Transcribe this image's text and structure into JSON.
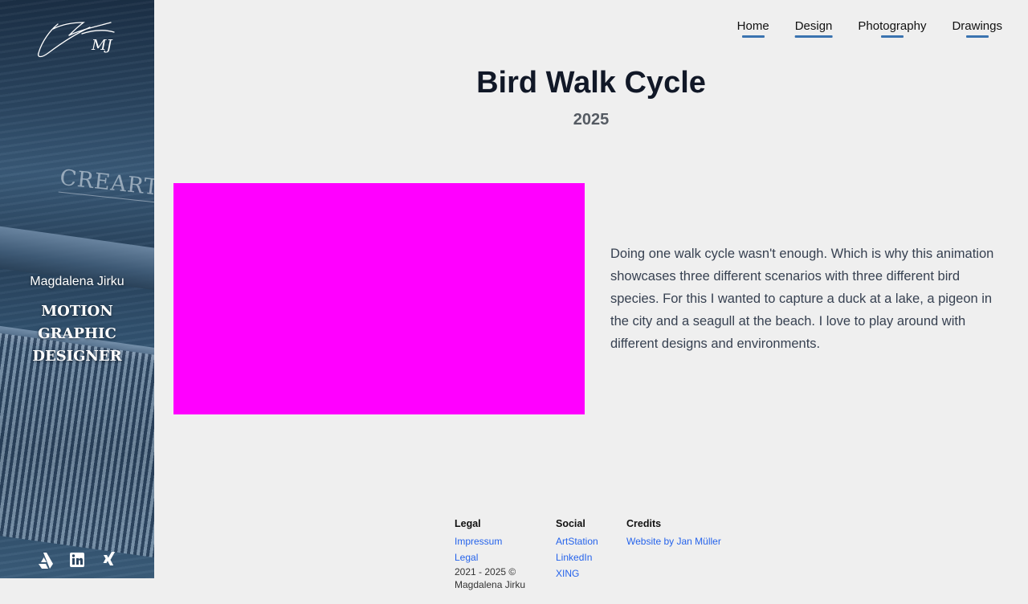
{
  "sidebar": {
    "logo_initials": "MJ",
    "engraving_text": "CREARTI",
    "name": "Magdalena Jirku",
    "role": "MOTION GRAPHIC DESIGNER",
    "social_icons": [
      "artstation-icon",
      "linkedin-icon",
      "xing-icon"
    ]
  },
  "nav": {
    "items": [
      {
        "label": "Home"
      },
      {
        "label": "Design",
        "active": true
      },
      {
        "label": "Photography"
      },
      {
        "label": "Drawings"
      }
    ],
    "underline_color": "#3a73b0"
  },
  "project": {
    "title": "Bird Walk Cycle",
    "year": "2025",
    "media_placeholder_color": "#ff00ff",
    "description": "Doing one walk cycle wasn't enough. Which is why this animation showcases three different scenarios with three different bird species. For this I wanted to capture a duck at a lake, a pigeon in the city and a seagull at the beach. I love to play around with different designs and environments."
  },
  "footer": {
    "legal": {
      "heading": "Legal",
      "links": [
        "Impressum",
        "Legal"
      ],
      "copyright": "2021 - 2025 © Magdalena Jirku"
    },
    "social": {
      "heading": "Social",
      "links": [
        "ArtStation",
        "LinkedIn",
        "XING"
      ]
    },
    "credits": {
      "heading": "Credits",
      "links": [
        "Website by Jan Müller"
      ]
    },
    "link_color": "#2563eb"
  }
}
